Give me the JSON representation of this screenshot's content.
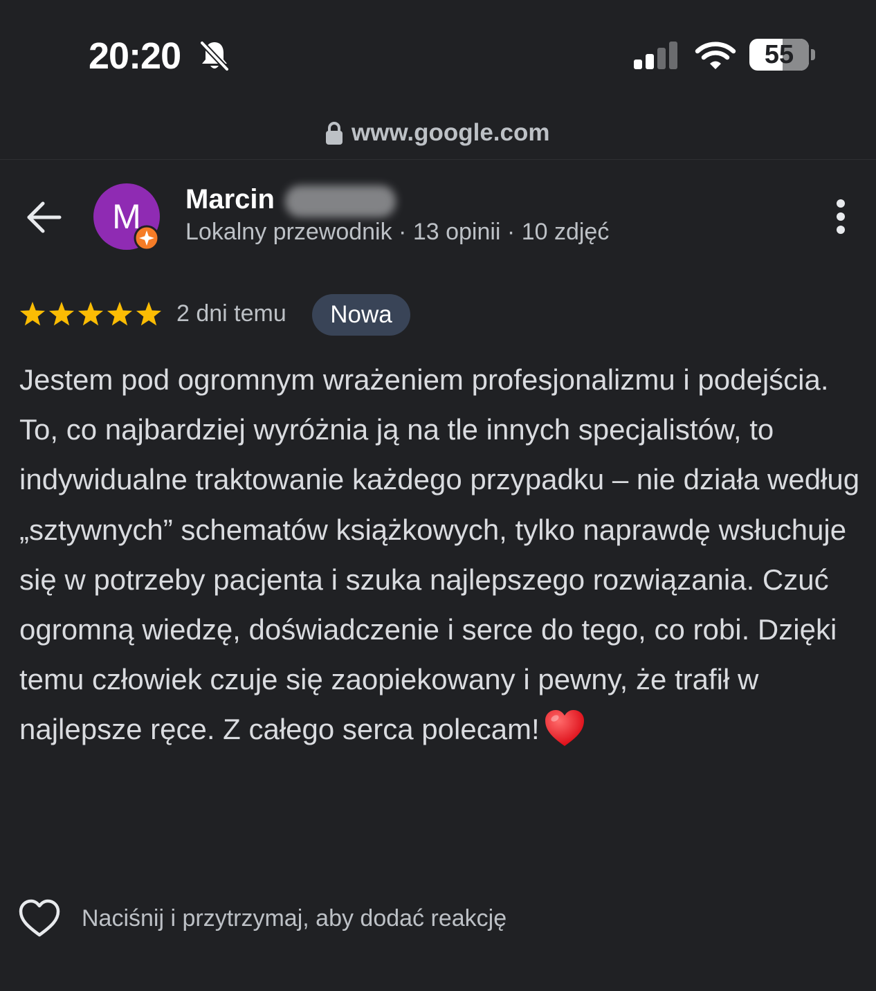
{
  "status_bar": {
    "time": "20:20",
    "battery_level": "55",
    "icons": [
      "bell-slash-icon",
      "signal-icon",
      "wifi-icon",
      "battery-icon"
    ]
  },
  "browser": {
    "url": "www.google.com",
    "icons": [
      "lock-icon"
    ]
  },
  "header": {
    "avatar_letter": "M",
    "reviewer_name": "Marcin",
    "reviewer_meta": "Lokalny przewodnik · 13 opinii · 10 zdjęć",
    "icons": [
      "back-arrow-icon",
      "local-guide-badge-icon",
      "more-vert-icon"
    ]
  },
  "review": {
    "rating": 5,
    "rating_max": 5,
    "date": "2 dni temu",
    "badge": "Nowa",
    "text": "Jestem pod ogromnym wrażeniem profesjonalizmu i podejścia.\nTo, co najbardziej wyróżnia ją na tle innych specjalistów, to indywidualne traktowanie każdego przypadku – nie działa według „sztywnych” schematów książkowych, tylko naprawdę wsłuchuje się w potrzeby pacjenta i szuka najlepszego rozwiązania. Czuć ogromną wiedzę, doświadczenie i serce do tego, co robi. Dzięki temu człowiek czuje się zaopiekowany i pewny, że trafił w najlepsze ręce. Z całego serca polecam!",
    "icons": [
      "star-icon",
      "red-heart-emoji-icon"
    ]
  },
  "reaction": {
    "hint": "Naciśnij i przytrzymaj, aby dodać reakcję",
    "icons": [
      "heart-outline-icon"
    ]
  },
  "colors": {
    "background": "#202124",
    "star": "#fbbc04",
    "avatar": "#8f2bb3",
    "badge_bg": "#394457",
    "guide_badge": "#f57c27"
  }
}
